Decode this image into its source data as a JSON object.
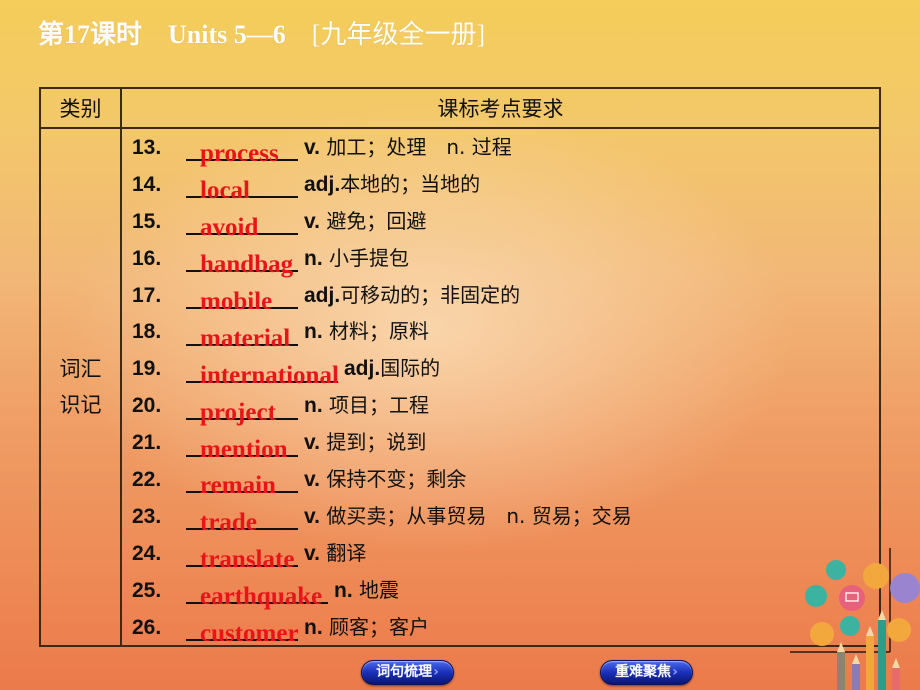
{
  "header": {
    "title_lesson": "第17课时",
    "title_units": "Units 5—6",
    "title_book": "[九年级全一册]"
  },
  "table": {
    "headers": [
      "类别",
      "课标考点要求"
    ],
    "category_line1": "词汇",
    "category_line2": "识记",
    "rows": [
      {
        "num": "13.",
        "answer": "process",
        "pos": "v.",
        "meaning": " 加工；处理　n. 过程"
      },
      {
        "num": "14.",
        "answer": "local",
        "pos": "adj.",
        "meaning": "本地的；当地的"
      },
      {
        "num": "15.",
        "answer": "avoid",
        "pos": "v.",
        "meaning": " 避免；回避"
      },
      {
        "num": "16.",
        "answer": "handbag",
        "pos": "n.",
        "meaning": " 小手提包"
      },
      {
        "num": "17.",
        "answer": "mobile",
        "pos": "adj.",
        "meaning": "可移动的；非固定的"
      },
      {
        "num": "18.",
        "answer": "material",
        "pos": "n.",
        "meaning": " 材料；原料"
      },
      {
        "num": "19.",
        "answer": "international",
        "pos": "adj.",
        "meaning": "国际的"
      },
      {
        "num": "20.",
        "answer": "project",
        "pos": "n.",
        "meaning": " 项目；工程"
      },
      {
        "num": "21.",
        "answer": "mention",
        "pos": "v.",
        "meaning": " 提到；说到"
      },
      {
        "num": "22.",
        "answer": "remain",
        "pos": "v.",
        "meaning": " 保持不变；剩余"
      },
      {
        "num": "23.",
        "answer": "trade",
        "pos": "v.",
        "meaning": " 做买卖；从事贸易　n. 贸易；交易"
      },
      {
        "num": "24.",
        "answer": "translate",
        "pos": "v.",
        "meaning": " 翻译"
      },
      {
        "num": "25.",
        "answer": "earthquake",
        "pos": "n.",
        "meaning": " 地震"
      },
      {
        "num": "26.",
        "answer": "customer",
        "pos": "n.",
        "meaning": " 顾客；客户"
      }
    ]
  },
  "nav": {
    "button1": "词句梳理",
    "button2": "重难聚焦",
    "arrow": "›"
  },
  "colors": {
    "answer": "#e8141a",
    "button": "#1a2fb8",
    "border": "#3a2a1a"
  }
}
